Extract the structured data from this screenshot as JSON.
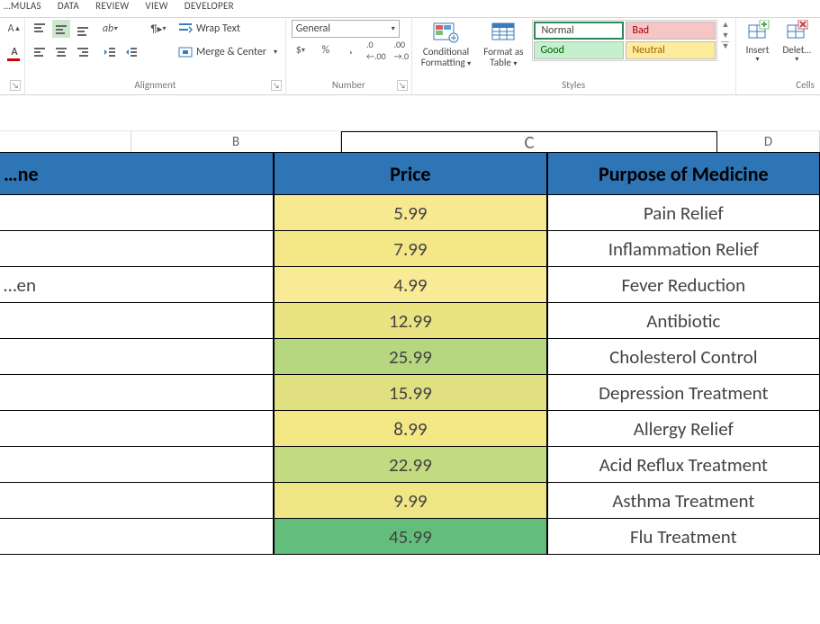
{
  "tabs": {
    "t0": "…MULAS",
    "t1": "DATA",
    "t2": "REVIEW",
    "t3": "VIEW",
    "t4": "DEVELOPER"
  },
  "ribbon": {
    "wrap_text": "Wrap Text",
    "merge_center": "Merge & Center",
    "alignment_label": "Alignment",
    "number_format": "General",
    "number_label": "Number",
    "cond_fmt_l1": "Conditional",
    "cond_fmt_l2": "Formatting",
    "fmt_table_l1": "Format as",
    "fmt_table_l2": "Table",
    "styles_label": "Styles",
    "style_normal": "Normal",
    "style_bad": "Bad",
    "style_good": "Good",
    "style_neutral": "Neutral",
    "insert": "Insert",
    "delete": "Delet…",
    "cells_label": "Cells"
  },
  "columns": {
    "a": "",
    "b": "B",
    "c": "C",
    "d": "D"
  },
  "header": {
    "a": "…ne",
    "b": "Price",
    "c": "Purpose of Medicine"
  },
  "rows": [
    {
      "a": "",
      "b": "5.99",
      "c": "Pain Relief",
      "bg": "#f7e990"
    },
    {
      "a": "",
      "b": "7.99",
      "c": "Inflammation Relief",
      "bg": "#f4e787"
    },
    {
      "a": "…en",
      "b": "4.99",
      "c": "Fever Reduction",
      "bg": "#f9eb95"
    },
    {
      "a": "",
      "b": "12.99",
      "c": "Antibiotic",
      "bg": "#eae381"
    },
    {
      "a": "",
      "b": "25.99",
      "c": "Cholesterol Control",
      "bg": "#b6d77f"
    },
    {
      "a": "",
      "b": "15.99",
      "c": "Depression Treatment",
      "bg": "#e0e081"
    },
    {
      "a": "",
      "b": "8.99",
      "c": "Allergy Relief",
      "bg": "#f3e786"
    },
    {
      "a": "",
      "b": "22.99",
      "c": "Acid Reflux Treatment",
      "bg": "#c2da80"
    },
    {
      "a": "",
      "b": "9.99",
      "c": "Asthma Treatment",
      "bg": "#f1e685"
    },
    {
      "a": "",
      "b": "45.99",
      "c": "Flu Treatment",
      "bg": "#63be7b"
    }
  ]
}
